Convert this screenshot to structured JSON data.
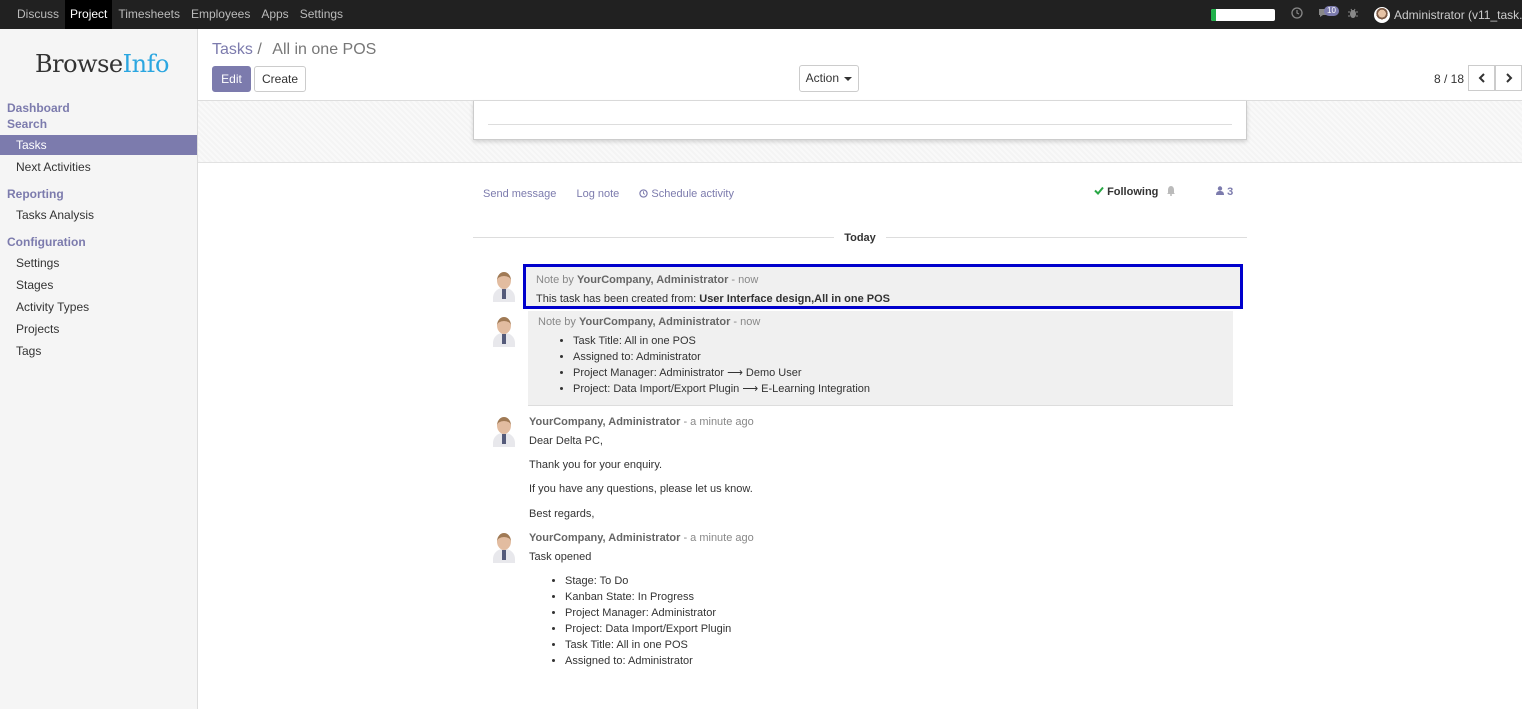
{
  "topbar": {
    "apps": [
      "Discuss",
      "Project",
      "Timesheets",
      "Employees",
      "Apps",
      "Settings"
    ],
    "active_app": "Project",
    "progress": 0.08,
    "messages_badge": "10",
    "user": "Administrator (v11_task."
  },
  "sidebar": {
    "brand_main": "Browse",
    "brand_accent": "Info",
    "sections": {
      "dashboard": "Dashboard",
      "search": "Search",
      "reporting": "Reporting",
      "configuration": "Configuration"
    },
    "items": {
      "tasks": "Tasks",
      "next_activities": "Next Activities",
      "tasks_analysis": "Tasks Analysis",
      "settings": "Settings",
      "stages": "Stages",
      "activity_types": "Activity Types",
      "projects": "Projects",
      "tags": "Tags"
    }
  },
  "control_panel": {
    "breadcrumb_parent": "Tasks",
    "breadcrumb_sep": "/",
    "breadcrumb_current": "All in one POS",
    "edit_label": "Edit",
    "create_label": "Create",
    "action_label": "Action",
    "pager": "8 / 18"
  },
  "chatter": {
    "send_message": "Send message",
    "log_note": "Log note",
    "schedule_activity": "Schedule activity",
    "following": "Following",
    "followers_count": "3",
    "today": "Today",
    "messages": [
      {
        "type_label": "Note by",
        "author": "YourCompany, Administrator",
        "time": "- now",
        "body_prefix": "This task has been created from:",
        "body_bold": "User Interface design,All in one POS"
      },
      {
        "type_label": "Note by",
        "author": "YourCompany, Administrator",
        "time": "- now",
        "items": [
          "Task Title: All in one POS",
          "Assigned to: Administrator",
          "Project Manager: Administrator ⟶ Demo User",
          "Project: Data Import/Export Plugin ⟶ E-Learning Integration"
        ]
      },
      {
        "author": "YourCompany, Administrator",
        "time": "- a minute ago",
        "paragraphs": [
          "Dear Delta PC,",
          "Thank you for your enquiry.",
          "If you have any questions, please let us know.",
          "Best regards,"
        ]
      },
      {
        "author": "YourCompany, Administrator",
        "time": "- a minute ago",
        "intro": "Task opened",
        "items": [
          "Stage: To Do",
          "Kanban State: In Progress",
          "Project Manager: Administrator",
          "Project: Data Import/Export Plugin",
          "Task Title: All in one POS",
          "Assigned to: Administrator"
        ]
      }
    ]
  }
}
